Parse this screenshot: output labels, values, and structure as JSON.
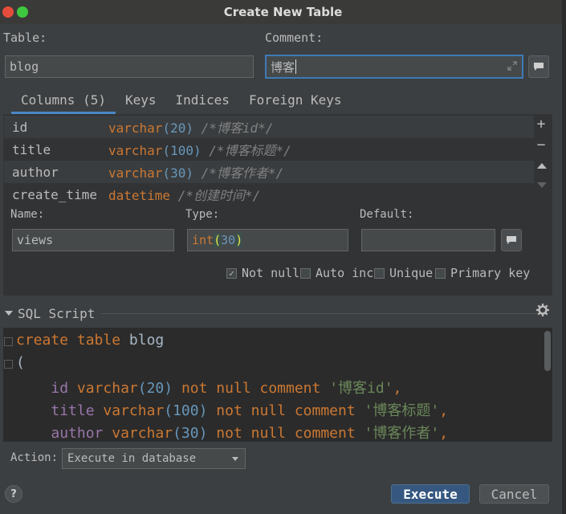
{
  "window": {
    "title": "Create New Table"
  },
  "form": {
    "table_label": "Table:",
    "table_value": "blog",
    "comment_label": "Comment:",
    "comment_value": "博客"
  },
  "tabs": [
    {
      "label": "Columns (5)",
      "active": true
    },
    {
      "label": "Keys",
      "active": false
    },
    {
      "label": "Indices",
      "active": false
    },
    {
      "label": "Foreign Keys",
      "active": false
    }
  ],
  "columns": [
    {
      "name": "id",
      "type": "varchar",
      "size": "(20)",
      "comment": "/*博客id*/"
    },
    {
      "name": "title",
      "type": "varchar",
      "size": "(100)",
      "comment": "/*博客标题*/"
    },
    {
      "name": "author",
      "type": "varchar",
      "size": "(30)",
      "comment": "/*博客作者*/"
    },
    {
      "name": "create_time",
      "type": "datetime",
      "size": "",
      "comment": "/*创建时间*/"
    }
  ],
  "editor": {
    "name_label": "Name:",
    "name_value": "views",
    "type_label": "Type:",
    "type_kw": "int",
    "type_open": "(",
    "type_num": "30",
    "type_close": ")",
    "default_label": "Default:",
    "default_value": ""
  },
  "options": [
    {
      "label": "Not null",
      "checked": true
    },
    {
      "label": "Auto inc",
      "checked": false
    },
    {
      "label": "Unique",
      "checked": false
    },
    {
      "label": "Primary key",
      "checked": false
    }
  ],
  "sql": {
    "header": "SQL Script",
    "line1_kw": "create table",
    "line1_name": "blog",
    "line2": "(",
    "lines": [
      {
        "ident": "id",
        "kw": "varchar",
        "size": "(20)",
        "rest": "not null comment",
        "str": "'博客id'",
        "end": ","
      },
      {
        "ident": "title",
        "kw": "varchar",
        "size": "(100)",
        "rest": "not null comment",
        "str": "'博客标题'",
        "end": ","
      },
      {
        "ident": "author",
        "kw": "varchar",
        "size": "(30)",
        "rest": "not null comment",
        "str": "'博客作者'",
        "end": ","
      }
    ]
  },
  "action": {
    "label": "Action:",
    "selected": "Execute in database"
  },
  "buttons": {
    "execute": "Execute",
    "cancel": "Cancel",
    "help": "?"
  },
  "icons": {
    "add": "plus-icon",
    "remove": "minus-icon",
    "up": "arrow-up-icon",
    "down": "arrow-down-icon",
    "settings": "gear-icon",
    "expand": "expand-icon",
    "comment": "comment-icon",
    "collapse": "triangle-down-icon"
  },
  "colors": {
    "accent": "#3d7ab8",
    "keyword": "#cc7832",
    "number": "#6897bb",
    "comment": "#808080",
    "string": "#6a8759",
    "identifier": "#9876aa"
  }
}
